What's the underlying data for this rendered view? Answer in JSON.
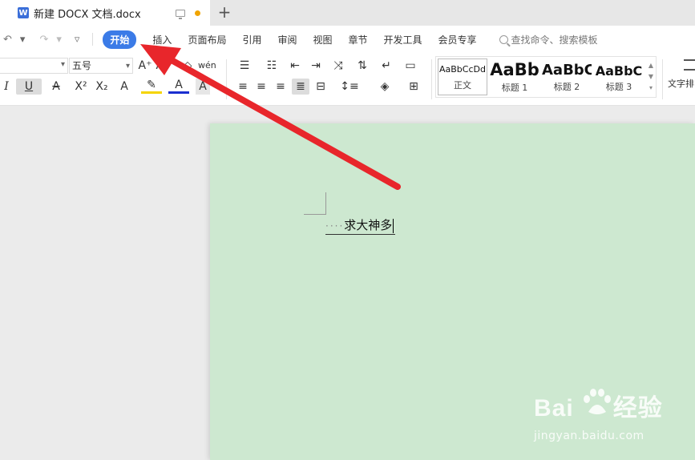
{
  "tab": {
    "app_badge": "W",
    "title": "新建 DOCX 文档.docx",
    "add_label": "+"
  },
  "menu": {
    "undo": "↶",
    "redo": "↷",
    "customize": "▿",
    "items": [
      "开始",
      "插入",
      "页面布局",
      "引用",
      "审阅",
      "视图",
      "章节",
      "开发工具",
      "会员专享"
    ],
    "search_placeholder": "查找命令、搜索模板"
  },
  "ribbon": {
    "font_size": "五号",
    "grow_font": "A⁺",
    "shrink_font": "A⁻",
    "clear_format": "◇",
    "phonetic": "wén",
    "italic": "I",
    "underline": "U",
    "strikethrough": "A",
    "superscript": "X²",
    "subscript": "X₂",
    "text_effect": "A",
    "highlight": "✎",
    "font_color": "A",
    "char_shading": "A",
    "styles": [
      {
        "sample": "AaBbCcDd",
        "label": "正文"
      },
      {
        "sample": "AaBb",
        "label": "标题 1"
      },
      {
        "sample": "AaBbC",
        "label": "标题 2"
      },
      {
        "sample": "AaBbC",
        "label": "标题 3"
      }
    ],
    "wordart_label": "文字排"
  },
  "document": {
    "dots": "····",
    "text": "求大神多"
  },
  "watermark": {
    "logo_left": "Bai",
    "logo_right": "经验",
    "url": "jingyan.baidu.com"
  },
  "colors": {
    "accent": "#3b7be7",
    "page_bg": "#cde8d0",
    "arrow": "#e8262b"
  }
}
